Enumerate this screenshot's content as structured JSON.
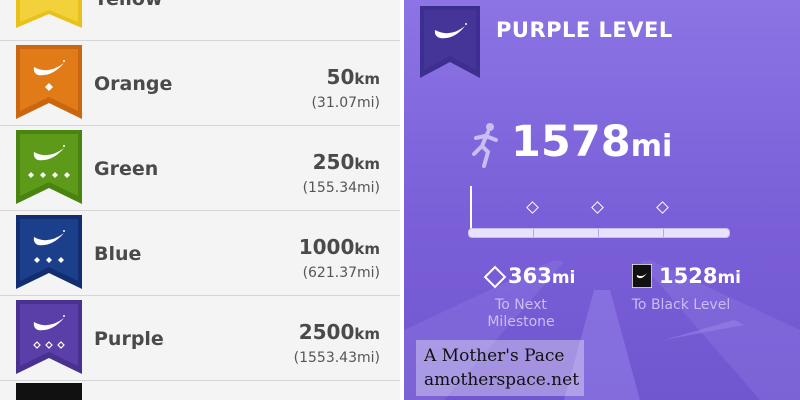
{
  "levels": [
    {
      "name": "Yellow",
      "km_value": "",
      "km_unit": "",
      "mi": ""
    },
    {
      "name": "Orange",
      "km_value": "50",
      "km_unit": "km",
      "mi": "(31.07mi)",
      "color": "#e07b17",
      "pips": 1
    },
    {
      "name": "Green",
      "km_value": "250",
      "km_unit": "km",
      "mi": "(155.34mi)",
      "color": "#5e9a1a",
      "pips": 4
    },
    {
      "name": "Blue",
      "km_value": "1000",
      "km_unit": "km",
      "mi": "(621.37mi)",
      "color": "#1c3f8c",
      "pips": 3
    },
    {
      "name": "Purple",
      "km_value": "2500",
      "km_unit": "km",
      "mi": "(1553.43mi)",
      "color": "#5a3fa8",
      "pips": 3
    }
  ],
  "panel": {
    "title": "PURPLE LEVEL",
    "total_value": "1578",
    "total_unit": "mi",
    "next_milestone_value": "363",
    "next_milestone_unit": "mi",
    "next_milestone_label_1": "To Next",
    "next_milestone_label_2": "Milestone",
    "black_level_value": "1528",
    "black_level_unit": "mi",
    "black_level_label": "To Black Level",
    "progress_fraction": 0.0
  },
  "watermark": {
    "line1": "A Mother's Pace",
    "line2": "amotherspace.net"
  },
  "colors": {
    "yellow": "#e8c21a",
    "panel_purple": "#7a5fd8",
    "badge_purple": "#3d2f8f"
  }
}
